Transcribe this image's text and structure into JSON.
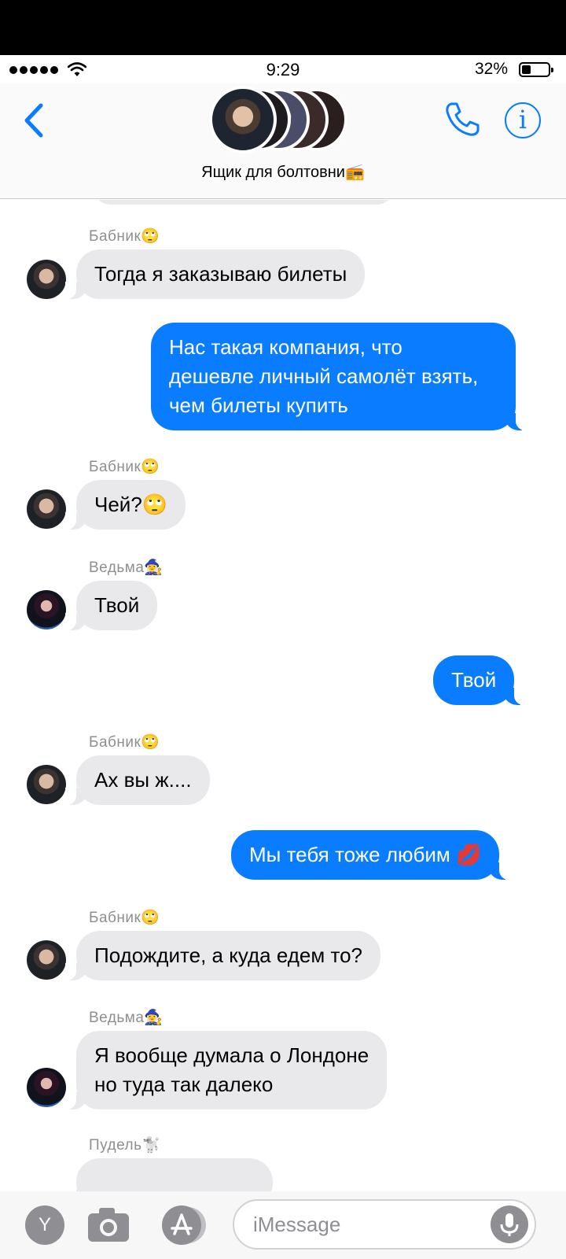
{
  "status_bar": {
    "time": "9:29",
    "battery": "32%",
    "battery_level": 0.32,
    "icons": [
      "signal-dots-icon",
      "wifi-icon",
      "battery-icon"
    ]
  },
  "header": {
    "group_name": "Ящик для болтовни📻",
    "back_icon": "chevron-left-icon",
    "call_icon": "phone-icon",
    "info_icon": "info-icon",
    "info_glyph": "i",
    "accent_color": "#0a7cff"
  },
  "messages": [
    {
      "sender": "Бабник🙄",
      "direction": "incoming",
      "text": "Тогда я заказываю билеты"
    },
    {
      "sender": "",
      "direction": "outgoing",
      "text": "Нас такая компания, что\nдешевле личный самолёт взять,\nчем билеты купить"
    },
    {
      "sender": "Бабник🙄",
      "direction": "incoming",
      "text": "Чей?🙄"
    },
    {
      "sender": "Ведьма🧙‍♀️",
      "direction": "incoming",
      "text": "Твой"
    },
    {
      "sender": "",
      "direction": "outgoing",
      "text": "Твой"
    },
    {
      "sender": "Бабник🙄",
      "direction": "incoming",
      "text": "Ах вы ж...."
    },
    {
      "sender": "",
      "direction": "outgoing",
      "text": "Мы тебя тоже любим 💋"
    },
    {
      "sender": "Бабник🙄",
      "direction": "incoming",
      "text": "Подождите, а куда едем то?"
    },
    {
      "sender": "Ведьма🧙‍♀️",
      "direction": "incoming",
      "text": "Я вообще думала о Лондоне\nно туда так далеко"
    },
    {
      "sender": "Пудель🐩",
      "direction": "incoming",
      "text": ""
    }
  ],
  "composer": {
    "placeholder": "iMessage",
    "app_button_label": "Y",
    "icons": [
      "app-y-icon",
      "camera-icon",
      "app-store-icon",
      "microphone-icon"
    ]
  },
  "colors": {
    "incoming_bubble": "#e9e9eb",
    "outgoing_bubble": "#0a7cff"
  }
}
